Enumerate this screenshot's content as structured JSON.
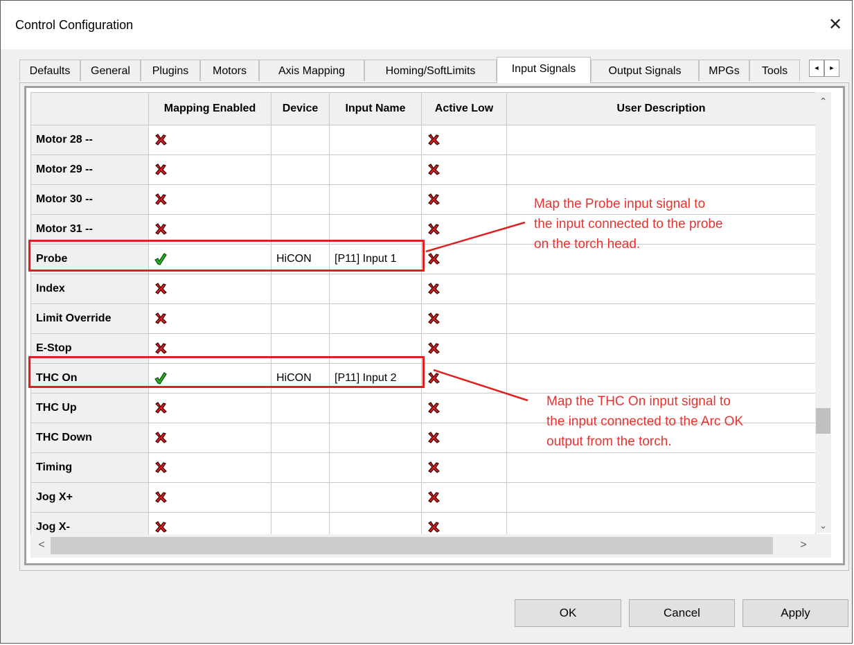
{
  "window": {
    "title": "Control Configuration",
    "close_glyph": "✕"
  },
  "tabs": [
    "Defaults",
    "General",
    "Plugins",
    "Motors",
    "Axis Mapping",
    "Homing/SoftLimits",
    "Input Signals",
    "Output Signals",
    "MPGs",
    "Tools"
  ],
  "active_tab": "Input Signals",
  "tab_scroll": {
    "left": "◄",
    "right": "►"
  },
  "table": {
    "columns": [
      "",
      "Mapping Enabled",
      "Device",
      "Input Name",
      "Active Low",
      "User Description"
    ],
    "rows": [
      {
        "name": "Motor 28 --",
        "mapping_enabled": false,
        "device": "",
        "input_name": "",
        "active_low": false,
        "user_description": ""
      },
      {
        "name": "Motor 29 --",
        "mapping_enabled": false,
        "device": "",
        "input_name": "",
        "active_low": false,
        "user_description": ""
      },
      {
        "name": "Motor 30 --",
        "mapping_enabled": false,
        "device": "",
        "input_name": "",
        "active_low": false,
        "user_description": ""
      },
      {
        "name": "Motor 31 --",
        "mapping_enabled": false,
        "device": "",
        "input_name": "",
        "active_low": false,
        "user_description": ""
      },
      {
        "name": "Probe",
        "mapping_enabled": true,
        "device": "HiCON",
        "input_name": "[P11] Input 1",
        "active_low": false,
        "user_description": ""
      },
      {
        "name": "Index",
        "mapping_enabled": false,
        "device": "",
        "input_name": "",
        "active_low": false,
        "user_description": ""
      },
      {
        "name": "Limit Override",
        "mapping_enabled": false,
        "device": "",
        "input_name": "",
        "active_low": false,
        "user_description": ""
      },
      {
        "name": "E-Stop",
        "mapping_enabled": false,
        "device": "",
        "input_name": "",
        "active_low": false,
        "user_description": ""
      },
      {
        "name": "THC On",
        "mapping_enabled": true,
        "device": "HiCON",
        "input_name": "[P11] Input 2",
        "active_low": false,
        "user_description": ""
      },
      {
        "name": "THC Up",
        "mapping_enabled": false,
        "device": "",
        "input_name": "",
        "active_low": false,
        "user_description": ""
      },
      {
        "name": "THC Down",
        "mapping_enabled": false,
        "device": "",
        "input_name": "",
        "active_low": false,
        "user_description": ""
      },
      {
        "name": "Timing",
        "mapping_enabled": false,
        "device": "",
        "input_name": "",
        "active_low": false,
        "user_description": ""
      },
      {
        "name": "Jog X+",
        "mapping_enabled": false,
        "device": "",
        "input_name": "",
        "active_low": false,
        "user_description": ""
      },
      {
        "name": "Jog X-",
        "mapping_enabled": false,
        "device": "",
        "input_name": "",
        "active_low": false,
        "user_description": ""
      }
    ]
  },
  "scrollbar": {
    "up": "⌃",
    "down": "⌄",
    "left": "<",
    "right": ">"
  },
  "annotations": {
    "probe": "Map the Probe input signal to\nthe input connected to the probe\non the torch head.",
    "thc": "Map the THC On input signal to\nthe input connected to the Arc OK\noutput from the torch."
  },
  "buttons": {
    "ok": "OK",
    "cancel": "Cancel",
    "apply": "Apply"
  },
  "colors": {
    "annotation_red": "#e02020",
    "x_red": "#d42020",
    "check_green": "#22b422"
  },
  "icons": {
    "disabled": "x-mark-icon",
    "enabled": "check-icon"
  }
}
